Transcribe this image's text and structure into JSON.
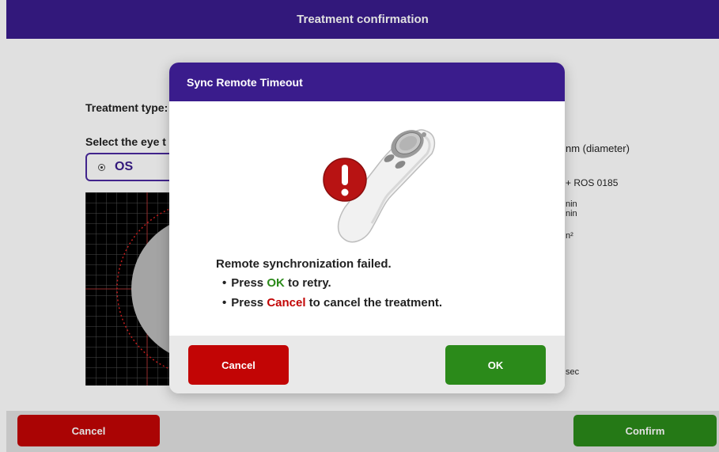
{
  "header": {
    "title": "Treatment confirmation"
  },
  "form": {
    "treatment_type_label": "Treatment type:",
    "select_eye_label": "Select the eye t",
    "eye_option": "OS"
  },
  "right_info": {
    "line1": "nm (diameter)",
    "line2": "+ ROS 0185",
    "line3": "nin",
    "line4": "nin",
    "line5": "n²",
    "line6": "sec"
  },
  "footer": {
    "cancel_label": "Cancel",
    "confirm_label": "Confirm"
  },
  "dialog": {
    "title": "Sync Remote Timeout",
    "message": "Remote synchronization failed.",
    "bullet1": {
      "prefix": "Press ",
      "keyword": "OK",
      "suffix": " to retry."
    },
    "bullet2": {
      "prefix": "Press ",
      "keyword": "Cancel",
      "suffix": " to cancel the treatment."
    },
    "cancel_label": "Cancel",
    "ok_label": "OK",
    "icon": "remote-error-icon"
  },
  "colors": {
    "purple": "#3a1c8c",
    "red": "#c20505",
    "green": "#2b8a1a"
  }
}
